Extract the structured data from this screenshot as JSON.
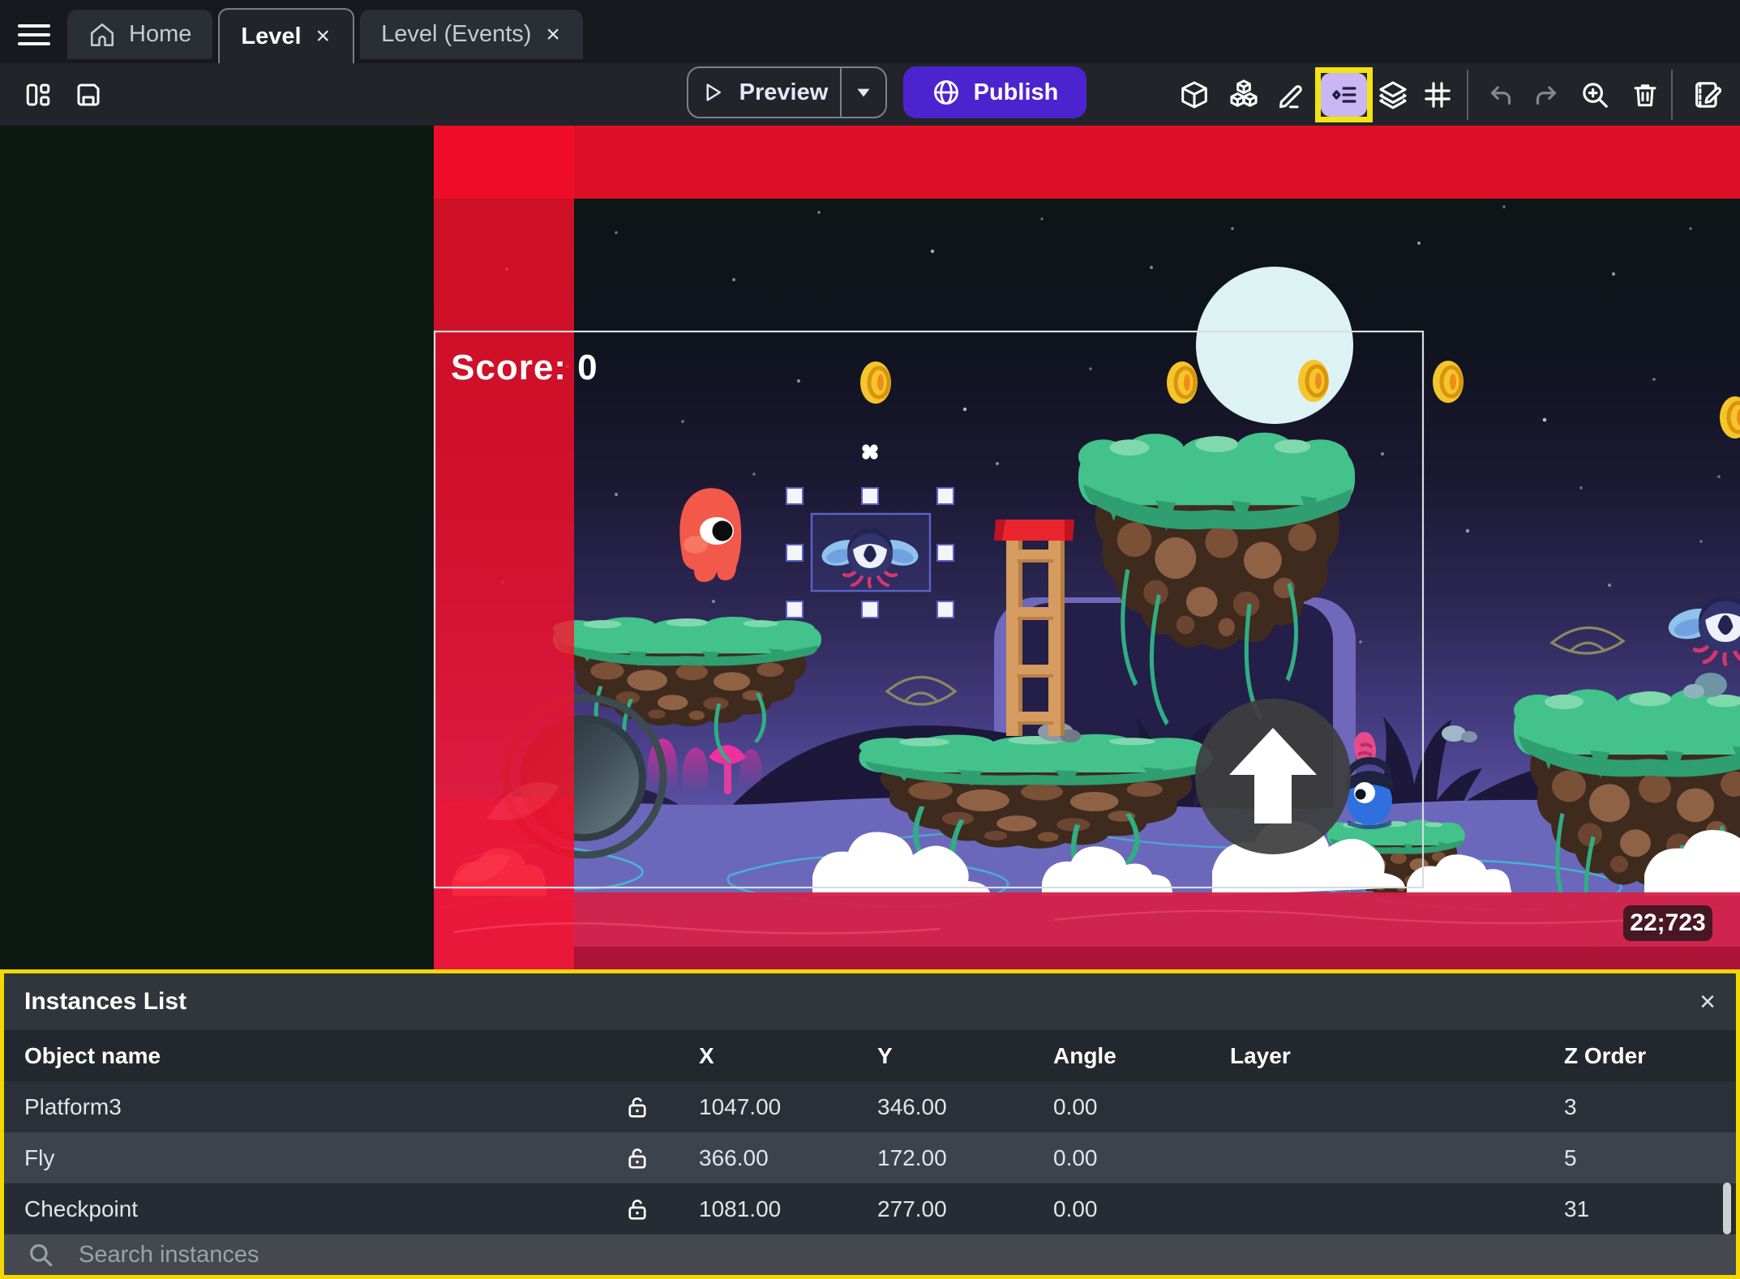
{
  "tabs": {
    "home_label": "Home",
    "level_label": "Level",
    "events_label": "Level (Events)",
    "close_symbol": "×"
  },
  "toolbar": {
    "preview_label": "Preview",
    "publish_label": "Publish",
    "icons": [
      "layout",
      "save",
      "cube-3d",
      "objects",
      "edit-pencil",
      "instances-list",
      "layers",
      "grid",
      "undo",
      "redo",
      "zoom-in",
      "trash",
      "edit-scene-properties"
    ]
  },
  "scene": {
    "score_label": "Score: 0",
    "coords_badge": "22;723",
    "selected_instance": "Fly"
  },
  "instances_panel": {
    "title": "Instances List",
    "close_symbol": "×",
    "columns": [
      "Object name",
      "X",
      "Y",
      "Angle",
      "Layer",
      "Z Order"
    ],
    "rows": [
      {
        "name": "Platform3",
        "x": "1047.00",
        "y": "346.00",
        "angle": "0.00",
        "layer": "",
        "z_order": "3"
      },
      {
        "name": "Fly",
        "x": "366.00",
        "y": "172.00",
        "angle": "0.00",
        "layer": "",
        "z_order": "5"
      },
      {
        "name": "Checkpoint",
        "x": "1081.00",
        "y": "277.00",
        "angle": "0.00",
        "layer": "",
        "z_order": "31"
      }
    ],
    "search_placeholder": "Search instances"
  },
  "colors": {
    "accent_purple": "#4b24cf",
    "highlight_yellow": "#f2d800",
    "camera_band_red": "#e30d26",
    "selection_blue": "#5a62c8"
  }
}
